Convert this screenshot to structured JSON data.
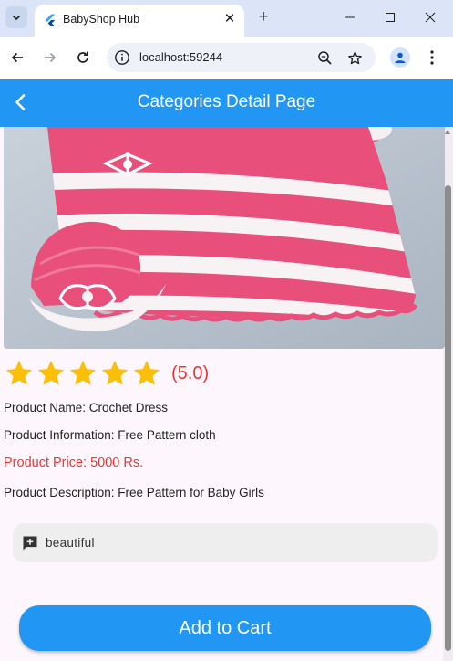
{
  "browser": {
    "tab_title": "BabyShop Hub",
    "url": "localhost:59244",
    "new_tab_symbol": "+",
    "tab_close_symbol": "✕"
  },
  "app": {
    "title": "Categories Detail Page",
    "accent_color": "#2196f3",
    "price_color": "#e53935",
    "star_color": "#fbbf0a"
  },
  "product": {
    "image": "crochet-dress-photo",
    "rating": 5,
    "rating_label": "(5.0)",
    "name_line": "Product Name:  Crochet Dress",
    "info_line": "Product Information: Free Pattern cloth",
    "price_line": "Product Price: 5000 Rs.",
    "description_line": "Product Description: Free Pattern for Baby Girls"
  },
  "comment": {
    "icon": "add-comment-icon",
    "text": "beautiful"
  },
  "actions": {
    "add_to_cart": "Add to Cart"
  }
}
